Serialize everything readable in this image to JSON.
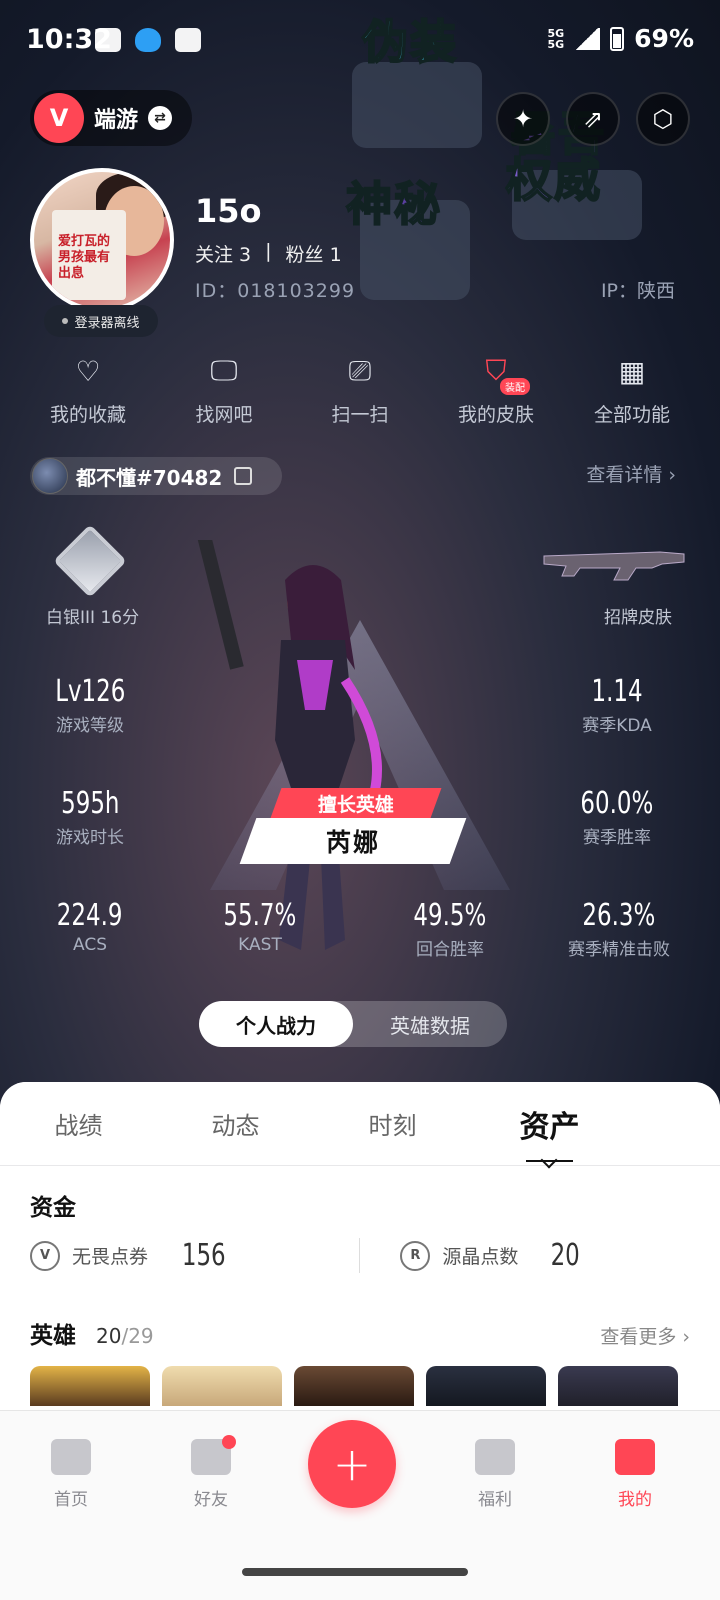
{
  "status_bar": {
    "time": "10:32",
    "network_top": "5G",
    "network_bottom": "5G",
    "battery": "69%"
  },
  "header": {
    "game_name": "端游"
  },
  "stickers": {
    "s1": "伪装",
    "s2": "神秘",
    "s3": "暑吾",
    "s4": "权威"
  },
  "profile": {
    "name": "15o",
    "follow_label": "关注 3",
    "divider": "|",
    "fans_label": "粉丝 1",
    "id": "ID：018103299",
    "ip": "IP：陕西",
    "login_status": "登录器离线",
    "avatar_book_text": "爱打瓦的男孩最有出息"
  },
  "quick_menu": [
    {
      "label": "我的收藏",
      "icon": "heart-icon"
    },
    {
      "label": "找网吧",
      "icon": "monitor-icon"
    },
    {
      "label": "扫一扫",
      "icon": "scan-icon"
    },
    {
      "label": "我的皮肤",
      "icon": "skin-icon",
      "badge": "装配"
    },
    {
      "label": "全部功能",
      "icon": "grid-icon"
    }
  ],
  "account": {
    "name": "都不懂#70482",
    "view_detail": "查看详情 ›"
  },
  "stats": {
    "rank": "白银III 16分",
    "skin": "招牌皮肤",
    "level_value": "Lv126",
    "level_label": "游戏等级",
    "kda_value": "1.14",
    "kda_label": "赛季KDA",
    "time_value": "595h",
    "time_label": "游戏时长",
    "winrate_value": "60.0%",
    "winrate_label": "赛季胜率",
    "acs_value": "224.9",
    "acs_label": "ACS",
    "kast_value": "55.7%",
    "kast_label": "KAST",
    "round_value": "49.5%",
    "round_label": "回合胜率",
    "hs_value": "26.3%",
    "hs_label": "赛季精准击败"
  },
  "featured": {
    "tag": "擅长英雄",
    "name": "芮娜"
  },
  "segmented": {
    "personal": "个人战力",
    "hero_data": "英雄数据"
  },
  "tabs": [
    "战绩",
    "动态",
    "时刻",
    "资产"
  ],
  "funds": {
    "title": "资金",
    "vp_label": "无畏点券",
    "vp_value": "156",
    "rp_label": "源晶点数",
    "rp_value": "20"
  },
  "heroes": {
    "title": "英雄",
    "count": "20",
    "total": "/29",
    "more": "查看更多 ›"
  },
  "bottom_nav": [
    "首页",
    "好友",
    "福利",
    "我的"
  ],
  "colors": {
    "accent": "#ff4655"
  }
}
